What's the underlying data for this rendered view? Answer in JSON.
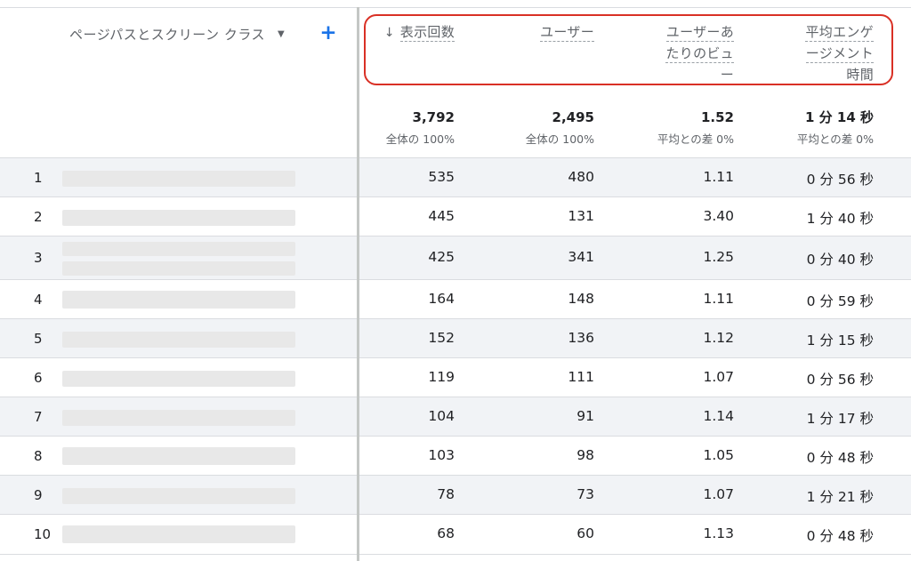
{
  "dimension": {
    "label": "ページパスとスクリーン クラス",
    "caret": "▼",
    "add": "+"
  },
  "metrics": {
    "views": {
      "label": "表示回数",
      "sort_icon": "↓"
    },
    "users": {
      "label": "ユーザー"
    },
    "views_per_user": {
      "line1": "ユーザーあ",
      "line2": "たりのビュ",
      "line3": "ー"
    },
    "avg_engagement": {
      "line1": "平均エンゲ",
      "line2": "ージメント",
      "line3": "時間"
    }
  },
  "totals": {
    "views": "3,792",
    "views_sub": "全体の 100%",
    "users": "2,495",
    "users_sub": "全体の 100%",
    "vpu": "1.52",
    "vpu_sub": "平均との差 0%",
    "eng": "1 分 14 秒",
    "eng_sub": "平均との差 0%"
  },
  "rows": [
    {
      "n": "1",
      "views": "535",
      "users": "480",
      "vpu": "1.11",
      "eng": "0 分 56 秒"
    },
    {
      "n": "2",
      "views": "445",
      "users": "131",
      "vpu": "3.40",
      "eng": "1 分 40 秒"
    },
    {
      "n": "3",
      "views": "425",
      "users": "341",
      "vpu": "1.25",
      "eng": "0 分 40 秒"
    },
    {
      "n": "4",
      "views": "164",
      "users": "148",
      "vpu": "1.11",
      "eng": "0 分 59 秒"
    },
    {
      "n": "5",
      "views": "152",
      "users": "136",
      "vpu": "1.12",
      "eng": "1 分 15 秒"
    },
    {
      "n": "6",
      "views": "119",
      "users": "111",
      "vpu": "1.07",
      "eng": "0 分 56 秒"
    },
    {
      "n": "7",
      "views": "104",
      "users": "91",
      "vpu": "1.14",
      "eng": "1 分 17 秒"
    },
    {
      "n": "8",
      "views": "103",
      "users": "98",
      "vpu": "1.05",
      "eng": "0 分 48 秒"
    },
    {
      "n": "9",
      "views": "78",
      "users": "73",
      "vpu": "1.07",
      "eng": "1 分 21 秒"
    },
    {
      "n": "10",
      "views": "68",
      "users": "60",
      "vpu": "1.13",
      "eng": "0 分 48 秒"
    }
  ]
}
